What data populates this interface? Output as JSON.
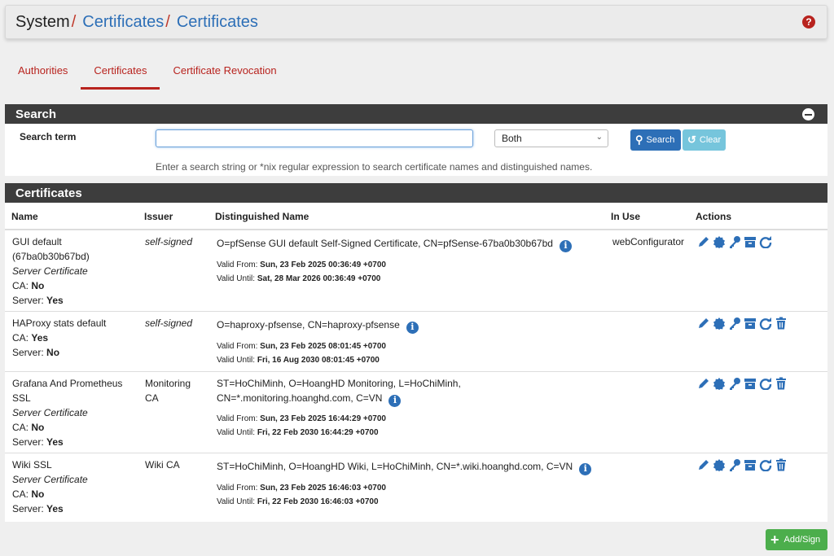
{
  "breadcrumb": {
    "root": "System",
    "sep": "/",
    "level1": "Certificates",
    "level2": "Certificates",
    "help": "?"
  },
  "tabs": [
    {
      "label": "Authorities"
    },
    {
      "label": "Certificates",
      "active": true
    },
    {
      "label": "Certificate Revocation"
    }
  ],
  "search": {
    "heading": "Search",
    "label": "Search term",
    "value": "",
    "placeholder": "",
    "scope": "Both",
    "search_button": "Search",
    "clear_button": "Clear",
    "hint": "Enter a search string or *nix regular expression to search certificate names and distinguished names."
  },
  "certificates": {
    "heading": "Certificates",
    "columns": {
      "name": "Name",
      "issuer": "Issuer",
      "dn": "Distinguished Name",
      "in_use": "In Use",
      "actions": "Actions"
    },
    "valid_from_label": "Valid From:",
    "valid_until_label": "Valid Until:",
    "ca_label": "CA:",
    "server_label": "Server:",
    "rows": [
      {
        "name_line1": "GUI default",
        "name_line2": "(67ba0b30b67bd)",
        "type": "Server Certificate",
        "ca": "No",
        "server": "Yes",
        "issuer": "self-signed",
        "dn_line1": "O=pfSense GUI default Self-Signed Certificate, CN=pfSense-67ba0b30b67bd",
        "dn_line2": "",
        "valid_from": "Sun, 23 Feb 2025 00:36:49 +0700",
        "valid_until": "Sat, 28 Mar 2026 00:36:49 +0700",
        "in_use": "webConfigurator"
      },
      {
        "name_line1": "HAProxy stats default",
        "name_line2": "",
        "type": "",
        "ca": "Yes",
        "server": "No",
        "issuer": "self-signed",
        "dn_line1": "O=haproxy-pfsense, CN=haproxy-pfsense",
        "dn_line2": "",
        "valid_from": "Sun, 23 Feb 2025 08:01:45 +0700",
        "valid_until": "Fri, 16 Aug 2030 08:01:45 +0700",
        "in_use": ""
      },
      {
        "name_line1": "Grafana And Prometheus",
        "name_line2": "SSL",
        "type": "Server Certificate",
        "ca": "No",
        "server": "Yes",
        "issuer": "Monitoring CA",
        "dn_line1": "ST=HoChiMinh, O=HoangHD Monitoring, L=HoChiMinh,",
        "dn_line2": "CN=*.monitoring.hoanghd.com, C=VN",
        "valid_from": "Sun, 23 Feb 2025 16:44:29 +0700",
        "valid_until": "Fri, 22 Feb 2030 16:44:29 +0700",
        "in_use": ""
      },
      {
        "name_line1": "Wiki SSL",
        "name_line2": "",
        "type": "Server Certificate",
        "ca": "No",
        "server": "Yes",
        "issuer": "Wiki CA",
        "dn_line1": "ST=HoChiMinh, O=HoangHD Wiki, L=HoChiMinh, CN=*.wiki.hoanghd.com, C=VN",
        "dn_line2": "",
        "valid_from": "Sun, 23 Feb 2025 16:46:03 +0700",
        "valid_until": "Fri, 22 Feb 2030 16:46:03 +0700",
        "in_use": ""
      }
    ]
  },
  "add_button": "Add/Sign",
  "colors": {
    "accent_blue": "#2d6fb7",
    "tab_red": "#b8231e",
    "heading_dark": "#3d3d3d",
    "add_green": "#4cae4c",
    "clear_cyan": "#76c5dc"
  }
}
